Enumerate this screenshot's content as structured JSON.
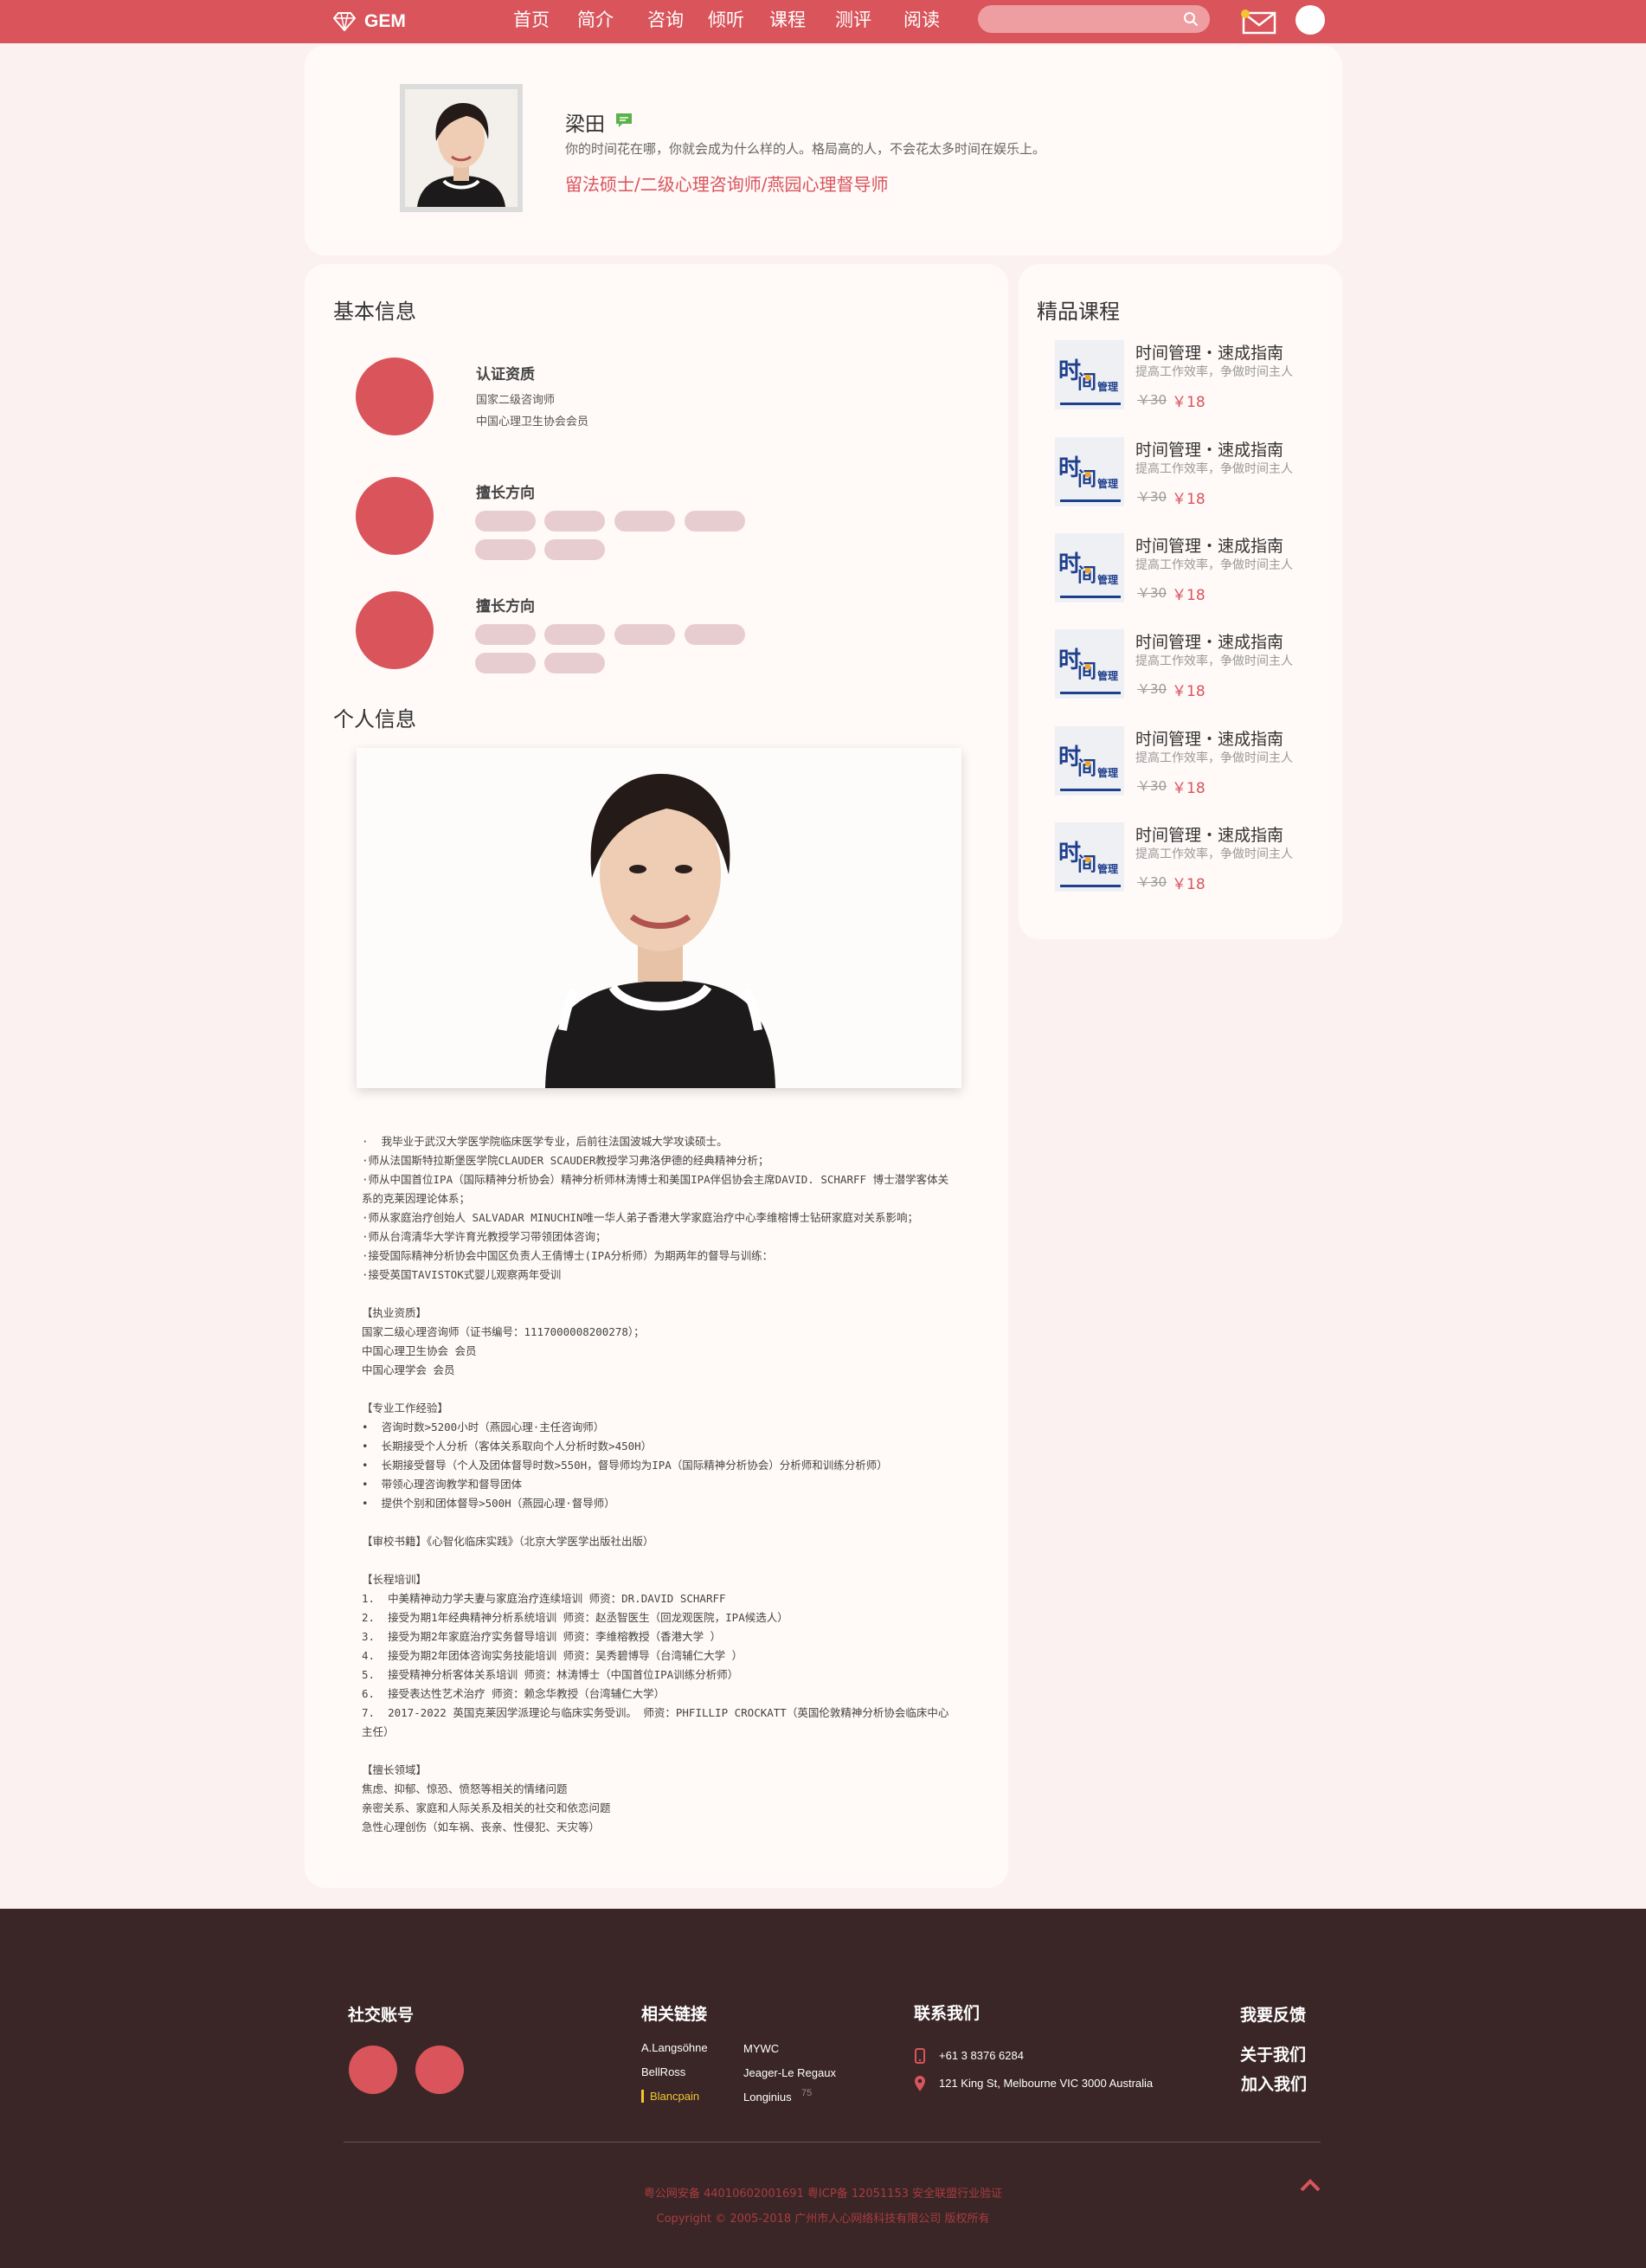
{
  "header": {
    "logo_text": "GEM",
    "nav": [
      "首页",
      "简介",
      "咨询",
      "倾听",
      "课程",
      "测评",
      "阅读"
    ],
    "search_placeholder": "",
    "accent_color": "#d9545b"
  },
  "profile": {
    "name": "梁田",
    "motto": "你的时间花在哪，你就会成为什么样的人。格局高的人，不会花太多时间在娱乐上。",
    "titles": "留法硕士/二级心理咨询师/燕园心理督导师"
  },
  "basic_info": {
    "title": "基本信息",
    "items": [
      {
        "heading": "认证资质",
        "lines": [
          "国家二级咨询师",
          "中国心理卫生协会会员"
        ]
      },
      {
        "heading": "擅长方向",
        "lines": []
      },
      {
        "heading": "擅长方向",
        "lines": []
      }
    ]
  },
  "personal_info": {
    "title": "个人信息",
    "bio": "·  我毕业于武汉大学医学院临床医学专业，后前往法国波城大学攻读硕士。\n·师从法国斯特拉斯堡医学院CLAUDER SCAUDER教授学习弗洛伊德的经典精神分析；\n·师从中国首位IPA（国际精神分析协会）精神分析师林涛博士和美国IPA伴侣协会主席DAVID. SCHARFF 博士潜学客体关系的克莱因理论体系；\n·师从家庭治疗创始人 SALVADAR MINUCHIN唯一华人弟子香港大学家庭治疗中心李维榕博士钻研家庭对关系影响；\n·师从台湾清华大学许育光教授学习带领团体咨询；\n·接受国际精神分析协会中国区负责人王倩博士(IPA分析师）为期两年的督导与训练：\n·接受英国TAVISTOK式婴儿观察两年受训\n\n【执业资质】\n国家二级心理咨询师（证书编号：1117000008200278）；\n中国心理卫生协会 会员\n中国心理学会 会员\n\n【专业工作经验】\n•  咨询时数>5200小时（燕园心理·主任咨询师）\n•  长期接受个人分析（客体关系取向个人分析时数>450H）\n•  长期接受督导（个人及团体督导时数>550H，督导师均为IPA（国际精神分析协会）分析师和训练分析师）\n•  带领心理咨询教学和督导团体\n•  提供个别和团体督导>500H（燕园心理·督导师）\n\n【审校书籍】《心智化临床实践》（北京大学医学出版社出版）\n\n【长程培训】\n1.  中美精神动力学夫妻与家庭治疗连续培训 师资：DR.DAVID SCHARFF\n2.  接受为期1年经典精神分析系统培训 师资：赵丞智医生（回龙观医院，IPA候选人）\n3.  接受为期2年家庭治疗实务督导培训 师资：李维榕教授（香港大学 ）\n4.  接受为期2年团体咨询实务技能培训 师资：吴秀碧博导（台湾辅仁大学 ）\n5.  接受精神分析客体关系培训 师资：林涛博士（中国首位IPA训练分析师）\n6.  接受表达性艺术治疗 师资：赖念华教授（台湾辅仁大学）\n7.  2017-2022 英国克莱因学派理论与临床实务受训。 师资：PHFILLIP CROCKATT（英国伦敦精神分析协会临床中心主任）\n\n【擅长领域】\n焦虑、抑郁、惊恐、愤怒等相关的情绪问题\n亲密关系、家庭和人际关系及相关的社交和依恋问题\n急性心理创伤（如车祸、丧亲、性侵犯、天灾等）"
  },
  "courses": {
    "title": "精品课程",
    "items": [
      {
        "title": "时间管理・速成指南",
        "subtitle": "提高工作效率，争做时间主人",
        "old_price": "￥30",
        "new_price": "￥18"
      },
      {
        "title": "时间管理・速成指南",
        "subtitle": "提高工作效率，争做时间主人",
        "old_price": "￥30",
        "new_price": "￥18"
      },
      {
        "title": "时间管理・速成指南",
        "subtitle": "提高工作效率，争做时间主人",
        "old_price": "￥30",
        "new_price": "￥18"
      },
      {
        "title": "时间管理・速成指南",
        "subtitle": "提高工作效率，争做时间主人",
        "old_price": "￥30",
        "new_price": "￥18"
      },
      {
        "title": "时间管理・速成指南",
        "subtitle": "提高工作效率，争做时间主人",
        "old_price": "￥30",
        "new_price": "￥18"
      },
      {
        "title": "时间管理・速成指南",
        "subtitle": "提高工作效率，争做时间主人",
        "old_price": "￥30",
        "new_price": "￥18"
      }
    ],
    "thumb_text": [
      "时",
      "间",
      "管理"
    ]
  },
  "footer": {
    "social_title": "社交账号",
    "links_title": "相关链接",
    "links_col1": [
      "A.Langsöhne",
      "BellRoss",
      "Blancpain"
    ],
    "links_col2": [
      "MYWC",
      "Jeager-Le Regaux",
      "Longinius"
    ],
    "longinius_count": "75",
    "contact_title": "联系我们",
    "phone": "+61 3 8376 6284",
    "address": "121 King St, Melbourne VIC 3000 Australia",
    "feedback": "我要反馈",
    "about": "关于我们",
    "join": "加入我们",
    "icp": "粤公网安备 44010602001691  粤ICP备 12051153  安全联盟行业验证",
    "copyright": "Copyright © 2005-2018 广州市人心网络科技有限公司 版权所有"
  }
}
